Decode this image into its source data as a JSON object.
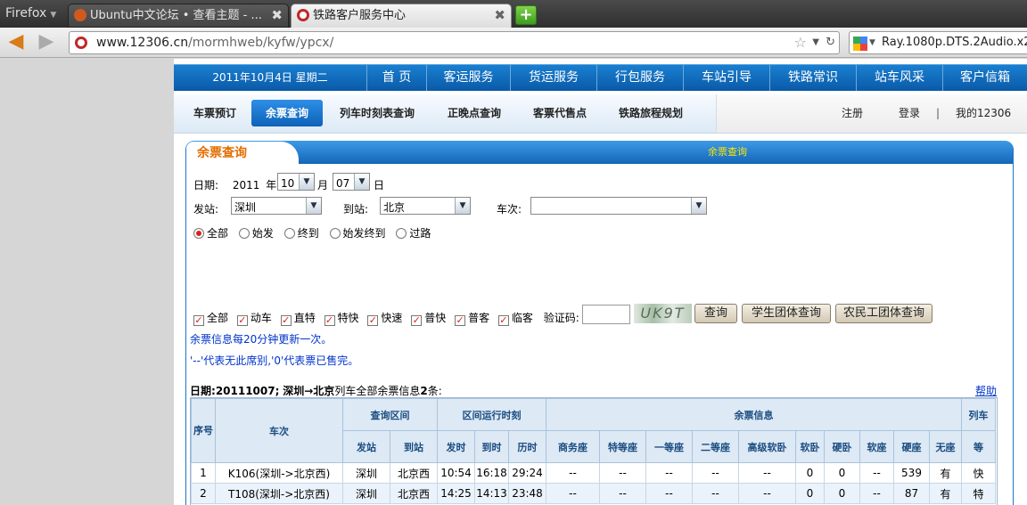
{
  "browser": {
    "menu_label": "Firefox",
    "tabs": [
      {
        "title": "Ubuntu中文论坛 • 查看主题 - ..."
      },
      {
        "title": "铁路客户服务中心"
      }
    ],
    "new_tab_label": "+",
    "url_host": "www.12306.cn",
    "url_path": "/mormhweb/kyfw/ypcx/",
    "search_text": "Ray.1080p.DTS.2Audio.x264"
  },
  "site": {
    "date_text": "2011年10月4日 星期二",
    "top_nav": [
      "首 页",
      "客运服务",
      "货运服务",
      "行包服务",
      "车站引导",
      "铁路常识",
      "站车风采",
      "客户信箱"
    ],
    "sub_nav": [
      "车票预订",
      "余票查询",
      "列车时刻表查询",
      "正晚点查询",
      "客票代售点",
      "铁路旅程规划"
    ],
    "sub_nav_active": 1,
    "account_links": [
      "注册",
      "登录",
      "|",
      "我的12306"
    ]
  },
  "panel": {
    "tab_label": "余票查询",
    "header_title": "余票查询"
  },
  "form": {
    "date_label": "日期:",
    "year": "2011",
    "year_suffix": "年",
    "month": "10",
    "month_suffix": "月",
    "day": "07",
    "day_suffix": "日",
    "from_label": "发站:",
    "from_value": "深圳",
    "to_label": "到站:",
    "to_value": "北京",
    "train_label": "车次:",
    "train_value": "",
    "station_types": [
      {
        "label": "全部",
        "selected": true
      },
      {
        "label": "始发",
        "selected": false
      },
      {
        "label": "终到",
        "selected": false
      },
      {
        "label": "始发终到",
        "selected": false
      },
      {
        "label": "过路",
        "selected": false
      }
    ],
    "train_types": [
      {
        "label": "全部",
        "checked": true
      },
      {
        "label": "动车",
        "checked": true
      },
      {
        "label": "直特",
        "checked": true
      },
      {
        "label": "特快",
        "checked": true
      },
      {
        "label": "快速",
        "checked": true
      },
      {
        "label": "普快",
        "checked": true
      },
      {
        "label": "普客",
        "checked": true
      },
      {
        "label": "临客",
        "checked": true
      }
    ],
    "captcha_label": "验证码:",
    "captcha_input": "",
    "captcha_image_text": "UK9T",
    "buttons": {
      "query": "查询",
      "student": "学生团体查询",
      "worker": "农民工团体查询"
    }
  },
  "notices": [
    "余票信息每20分钟更新一次。",
    "'--'代表无此席别,'0'代表票已售完。"
  ],
  "summary": {
    "prefix": "日期:",
    "date": "20111007",
    "sep": ";",
    "route": "深圳→北京",
    "rest": "列车全部余票信息",
    "count": "2",
    "suffix": "条:"
  },
  "help_label": "帮助",
  "table": {
    "group_headers": {
      "seq": "序号",
      "train": "车次",
      "section": "查询区间",
      "runtime": "区间运行时刻",
      "tickets": "余票信息",
      "level": "列车"
    },
    "sub_headers": [
      "发站",
      "到站",
      "发时",
      "到时",
      "历时",
      "商务座",
      "特等座",
      "一等座",
      "二等座",
      "高级软卧",
      "软卧",
      "硬卧",
      "软座",
      "硬座",
      "无座",
      "等"
    ],
    "rows": [
      [
        "1",
        "K106(深圳->北京西)",
        "深圳",
        "北京西",
        "10:54",
        "16:18",
        "29:24",
        "--",
        "--",
        "--",
        "--",
        "--",
        "0",
        "0",
        "--",
        "539",
        "有",
        "快"
      ],
      [
        "2",
        "T108(深圳->北京西)",
        "深圳",
        "北京西",
        "14:25",
        "14:13",
        "23:48",
        "--",
        "--",
        "--",
        "--",
        "--",
        "0",
        "0",
        "--",
        "87",
        "有",
        "特"
      ]
    ]
  }
}
